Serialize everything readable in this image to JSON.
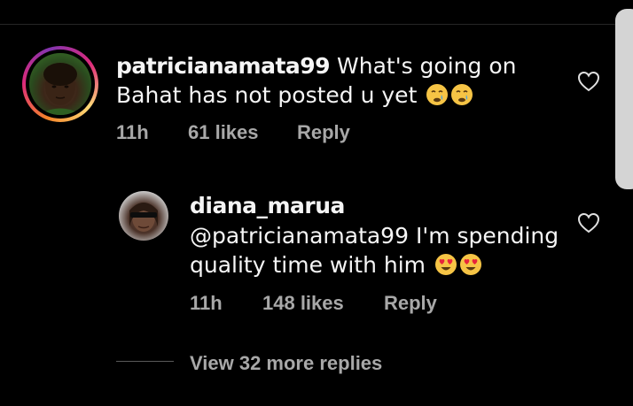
{
  "comment": {
    "username": "patricianamata99",
    "text_line1": " What's going on",
    "text_line2": "Bahat has not posted u yet",
    "emojis": [
      "crying-face-emoji",
      "crying-face-emoji"
    ],
    "time": "11h",
    "likes": "61 likes",
    "reply_label": "Reply"
  },
  "reply": {
    "username": "diana_marua",
    "text_line1": "@patricianamata99 I'm spending",
    "text_line2": "quality time with him ",
    "emojis": [
      "heart-eyes-emoji",
      "heart-eyes-emoji"
    ],
    "time": "11h",
    "likes": "148 likes",
    "reply_label": "Reply"
  },
  "view_more_replies": "View 32 more replies",
  "colors": {
    "background": "#000000",
    "text": "#f5f5f5",
    "meta": "#a8a8a8",
    "scrollbar": "#d4d4d4"
  }
}
